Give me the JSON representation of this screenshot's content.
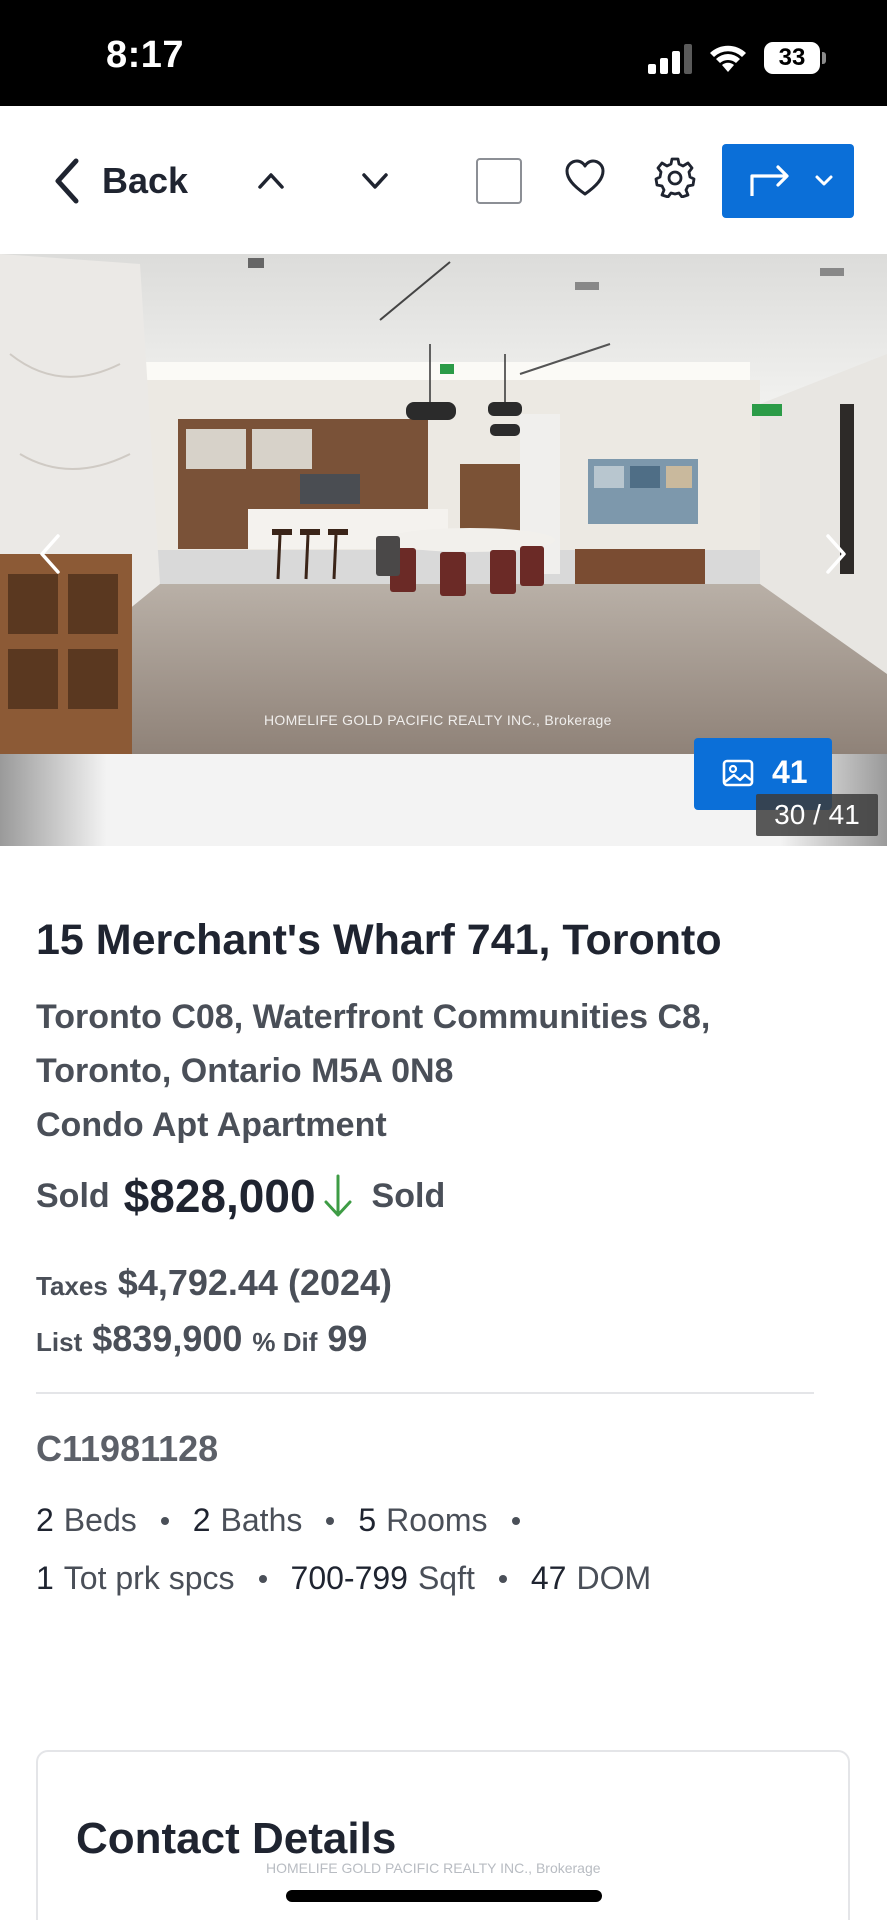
{
  "status_bar": {
    "time": "8:17",
    "battery": "33"
  },
  "toolbar": {
    "back_label": "Back",
    "accent_color": "#0b6fd8"
  },
  "gallery": {
    "watermark": "HOMELIFE GOLD PACIFIC REALTY INC., Brokerage",
    "photo_count": "41",
    "photo_index": "30 / 41"
  },
  "listing": {
    "title": "15 Merchant's Wharf 741, Toronto",
    "address_line1": "Toronto C08, Waterfront Communities C8,",
    "address_line2": "Toronto, Ontario M5A 0N8",
    "property_type": "Condo Apt Apartment",
    "sold_label": "Sold",
    "sold_price": "$828,000",
    "status": "Sold",
    "taxes_label": "Taxes",
    "taxes_value": "$4,792.44 (2024)",
    "list_label": "List",
    "list_price": "$839,900",
    "dif_label": "% Dif",
    "dif_value": "99",
    "mls_number": "C11981128",
    "facts": {
      "beds_num": "2",
      "beds_unit": "Beds",
      "baths_num": "2",
      "baths_unit": "Baths",
      "rooms_num": "5",
      "rooms_unit": "Rooms",
      "parking_num": "1",
      "parking_unit": "Tot prk spcs",
      "sqft_num": "700-799",
      "sqft_unit": "Sqft",
      "dom_num": "47",
      "dom_unit": "DOM"
    }
  },
  "contact": {
    "title": "Contact Details",
    "watermark": "HOMELIFE GOLD PACIFIC REALTY INC., Brokerage"
  }
}
